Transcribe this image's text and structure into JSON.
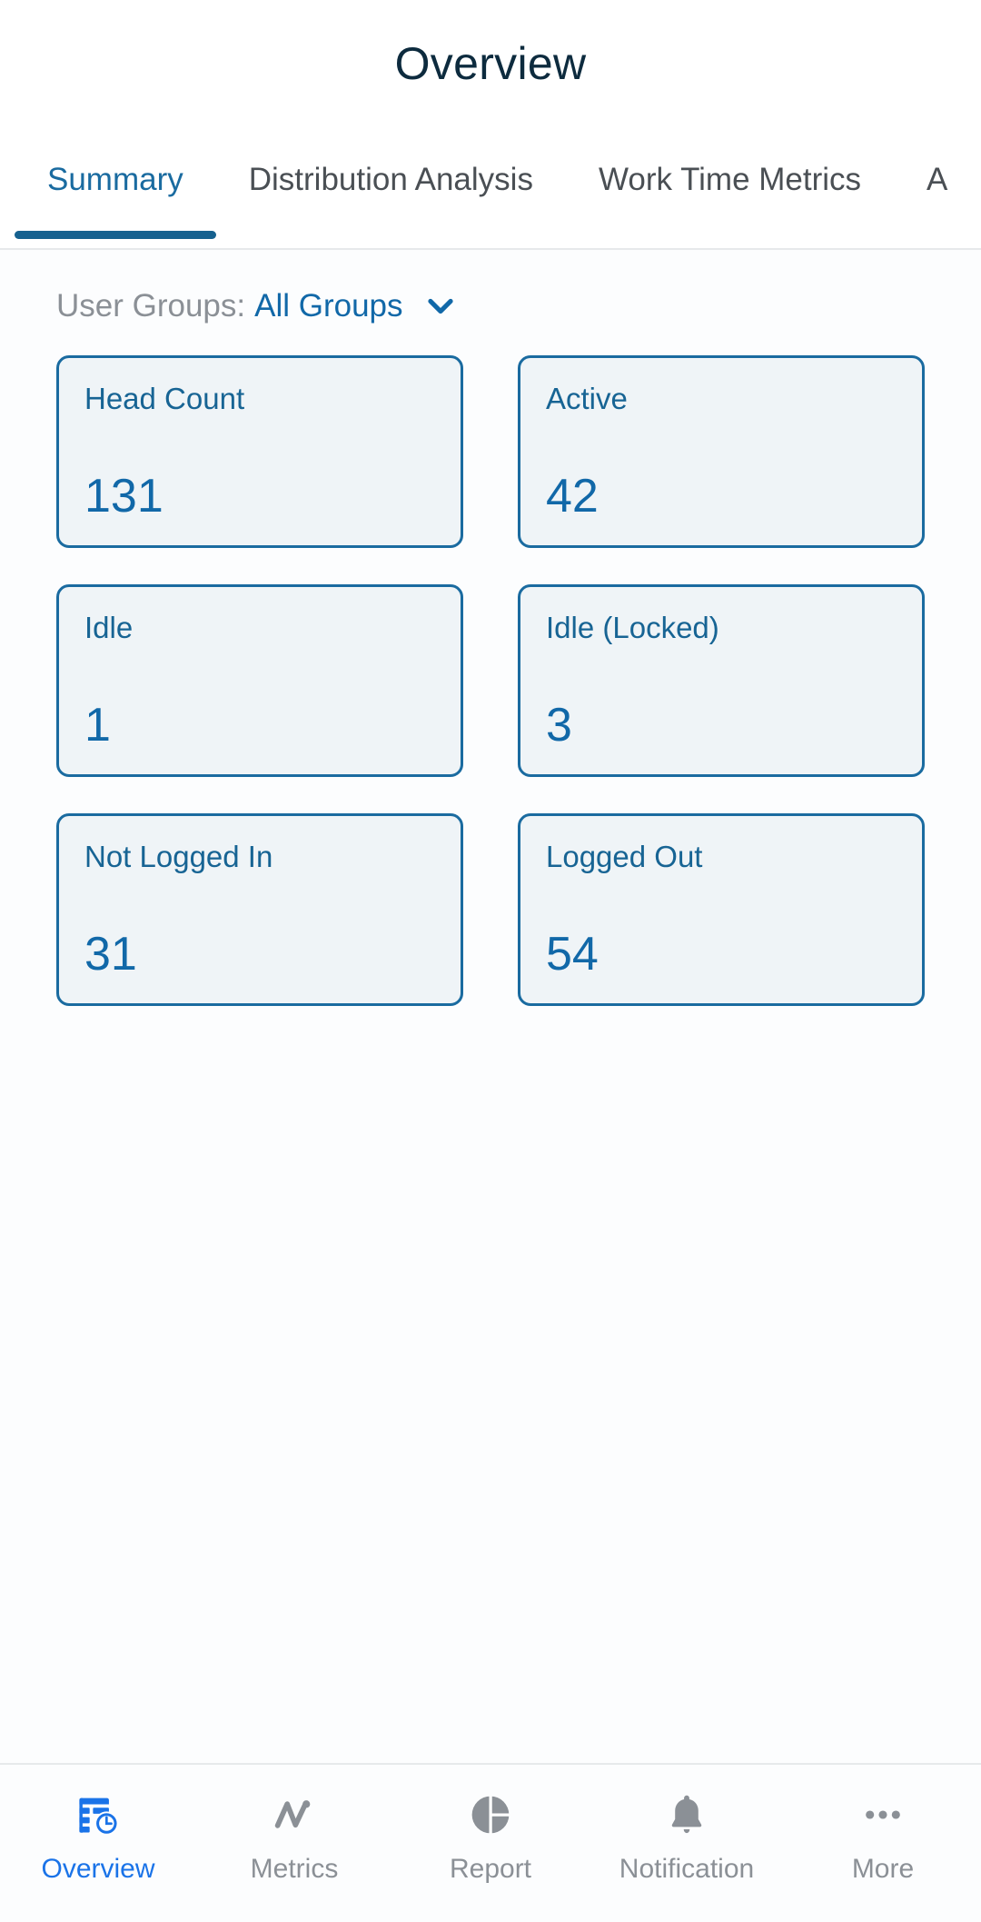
{
  "header": {
    "title": "Overview"
  },
  "tabs": [
    {
      "label": "Summary",
      "active": true
    },
    {
      "label": "Distribution Analysis",
      "active": false
    },
    {
      "label": "Work Time Metrics",
      "active": false
    },
    {
      "label": "A",
      "active": false
    }
  ],
  "filter": {
    "label": "User Groups:",
    "value": "All Groups",
    "chevron_icon": "chevron-down-icon"
  },
  "cards": [
    {
      "label": "Head Count",
      "value": "131"
    },
    {
      "label": "Active",
      "value": "42"
    },
    {
      "label": "Idle",
      "value": "1"
    },
    {
      "label": "Idle (Locked)",
      "value": "3"
    },
    {
      "label": "Not Logged In",
      "value": "31"
    },
    {
      "label": "Logged Out",
      "value": "54"
    }
  ],
  "bottom_nav": [
    {
      "label": "Overview",
      "icon": "grid-clock-icon",
      "active": true
    },
    {
      "label": "Metrics",
      "icon": "line-chart-icon",
      "active": false
    },
    {
      "label": "Report",
      "icon": "pie-chart-icon",
      "active": false
    },
    {
      "label": "Notification",
      "icon": "bell-icon",
      "active": false
    },
    {
      "label": "More",
      "icon": "ellipsis-icon",
      "active": false
    }
  ],
  "colors": {
    "accent_blue": "#1168a8",
    "tab_active": "#1a6ba0",
    "nav_active": "#1a73e8",
    "card_fill": "#eff4f7",
    "card_border": "#1a6ba0",
    "muted_text": "#8b9096",
    "title_text": "#0d2b3e"
  }
}
